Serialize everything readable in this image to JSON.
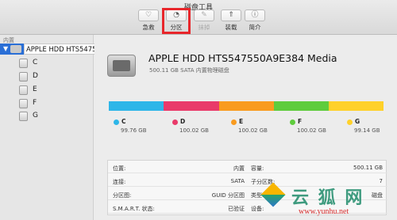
{
  "window": {
    "title": "磁盘工具"
  },
  "toolbar": [
    {
      "label": "急救",
      "glyph": "♡",
      "enabled": true
    },
    {
      "label": "分区",
      "glyph": "◔",
      "enabled": true
    },
    {
      "label": "抹掉",
      "glyph": "✎",
      "enabled": false
    },
    {
      "label": "装载",
      "glyph": "⇑",
      "enabled": true
    },
    {
      "label": "简介",
      "glyph": "ⓘ",
      "enabled": true
    }
  ],
  "sidebar": {
    "section": "内置",
    "disk_tooltip": "APPLE HDD HTS547550A9E384 Media",
    "volumes": [
      "C",
      "D",
      "E",
      "F",
      "G"
    ]
  },
  "disk": {
    "name": "APPLE HDD HTS547550A9E384 Media",
    "info": "500.11 GB SATA 内置物理磁盘"
  },
  "partitions": [
    {
      "name": "C",
      "size": "99.76 GB",
      "color": "#2eb6e8",
      "gb": 99.76
    },
    {
      "name": "D",
      "size": "100.02 GB",
      "color": "#e93a6a",
      "gb": 100.02
    },
    {
      "name": "E",
      "size": "100.02 GB",
      "color": "#f99b1f",
      "gb": 100.02
    },
    {
      "name": "F",
      "size": "100.02 GB",
      "color": "#5fcc3d",
      "gb": 100.02
    },
    {
      "name": "G",
      "size": "99.14 GB",
      "color": "#ffd12a",
      "gb": 99.14
    }
  ],
  "info_rows": [
    {
      "k1": "位置:",
      "v1": "内置",
      "k2": "容量:",
      "v2": "500.11 GB"
    },
    {
      "k1": "连接:",
      "v1": "SATA",
      "k2": "子分区数:",
      "v2": "7"
    },
    {
      "k1": "分区图:",
      "v1": "GUID 分区图",
      "k2": "类型:",
      "v2": "磁盘"
    },
    {
      "k1": "S.M.A.R.T. 状态:",
      "v1": "已验证",
      "k2": "设备:",
      "v2": ""
    }
  ],
  "watermark": {
    "text": "云 狐 网",
    "url": "www.yunhu.net"
  }
}
